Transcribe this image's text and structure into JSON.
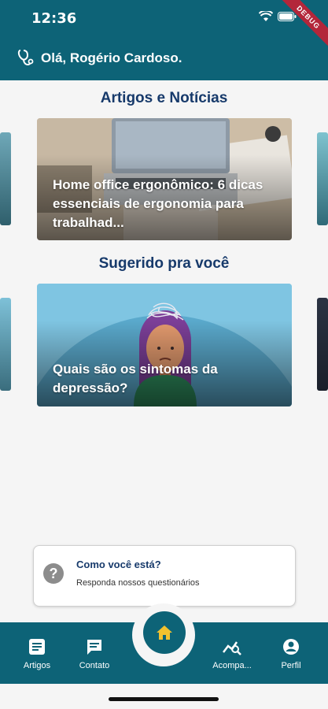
{
  "status_bar": {
    "time": "12:36",
    "debug_label": "DEBUG"
  },
  "header": {
    "greeting": "Olá, Rogério Cardoso."
  },
  "sections": {
    "articles_title": "Artigos e Notícias",
    "suggested_title": "Sugerido pra você"
  },
  "cards": {
    "article_title": "Home office ergonômico: 6 dicas essenciais de ergonomia para trabalhad...",
    "suggested_title": "Quais são os sintomas da depressão?"
  },
  "mood": {
    "title": "Como você está?",
    "subtitle": "Responda nossos questionários"
  },
  "nav": {
    "items": [
      {
        "label": "Artigos",
        "icon": "article-icon"
      },
      {
        "label": "Contato",
        "icon": "chat-icon"
      },
      {
        "label": "",
        "icon": "home-icon"
      },
      {
        "label": "Acompa...",
        "icon": "tracking-icon"
      },
      {
        "label": "Perfil",
        "icon": "profile-icon"
      }
    ]
  },
  "colors": {
    "primary": "#0d6377",
    "title": "#173a6b",
    "background": "#f5f5f5"
  }
}
